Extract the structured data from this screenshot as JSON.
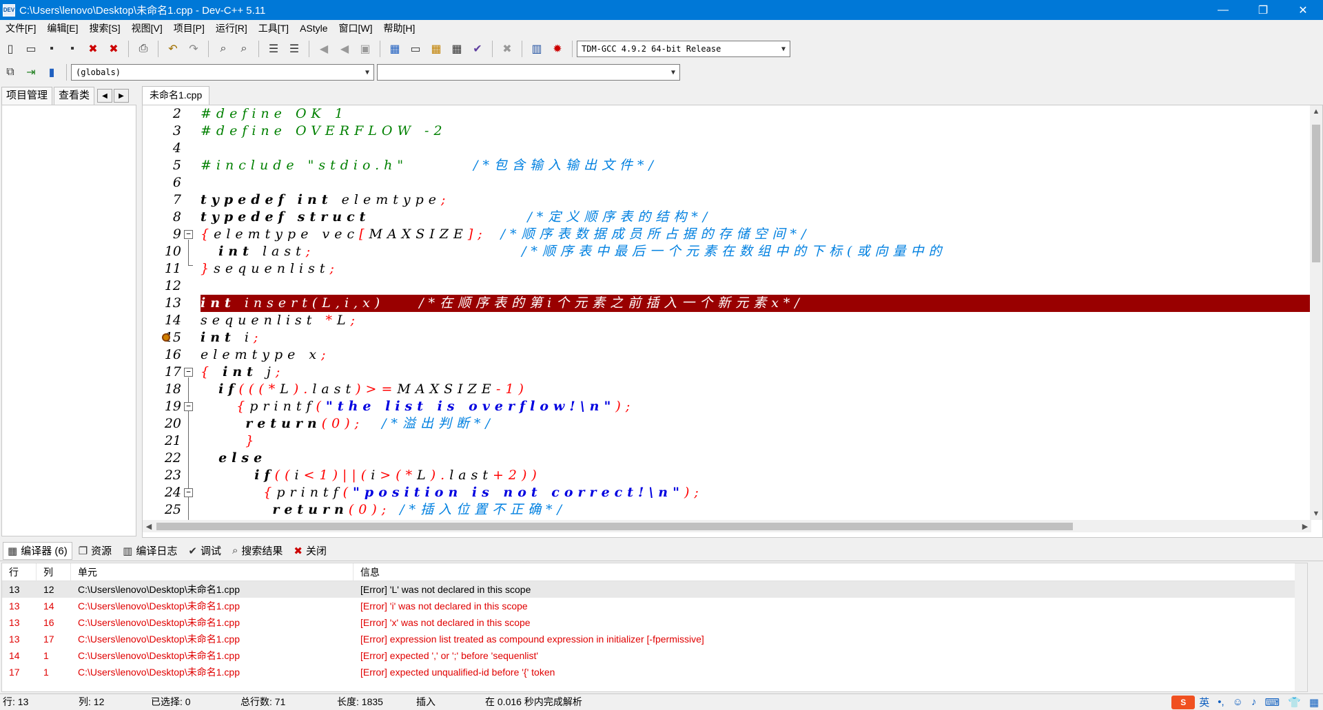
{
  "window": {
    "title": "C:\\Users\\lenovo\\Desktop\\未命名1.cpp - Dev-C++ 5.11",
    "app_icon_text": "DEV",
    "minimize": "—",
    "maximize": "❐",
    "close": "✕"
  },
  "menu": [
    "文件[F]",
    "编辑[E]",
    "搜索[S]",
    "视图[V]",
    "项目[P]",
    "运行[R]",
    "工具[T]",
    "AStyle",
    "窗口[W]",
    "帮助[H]"
  ],
  "toolbar": {
    "compiler_select": "TDM-GCC 4.9.2 64-bit Release",
    "scope_select": "(globals)",
    "member_select": ""
  },
  "left_panel": {
    "tabs": [
      "项目管理",
      "查看类"
    ],
    "nav_prev": "◀",
    "nav_next": "▶"
  },
  "editor": {
    "tab": "未命名1.cpp",
    "line_numbers": [
      "2",
      "3",
      "4",
      "5",
      "6",
      "7",
      "8",
      "9",
      "10",
      "11",
      "12",
      "13",
      "14",
      "15",
      "16",
      "17",
      "18",
      "19",
      "20",
      "21",
      "22",
      "23",
      "24",
      "25"
    ],
    "lines": {
      "l2a": "#define OK 1",
      "l3a": "#define OVERFLOW -2",
      "l5a": "#include \"stdio.h\"",
      "l5c": "/*包含输入输出文件*/",
      "l7k1": "typedef",
      "l7k2": "int",
      "l7t": "elemtype",
      "l7r": ";",
      "l8k1": "typedef",
      "l8k2": "struct",
      "l8c": "/*定义顺序表的结构*/",
      "l9r1": "{",
      "l9t": "elemtype vec",
      "l9r2": "[",
      "l9t2": "MAXSIZE",
      "l9r3": "];",
      "l9c": "/*顺序表数据成员所占据的存储空间*/",
      "l10k": "int",
      "l10t": "last",
      "l10r": ";",
      "l10c": "/*顺序表中最后一个元素在数组中的下标(或向量中的",
      "l11r1": "}",
      "l11t": "sequenlist",
      "l11r2": ";",
      "l13k": "int",
      "l13t": "insert",
      "l13b": "(L,i,x)",
      "l13c": "/*在顺序表的第i个元素之前插入一个新元素x*/",
      "l14t": "sequenlist",
      "l14r": "*",
      "l14t2": "L",
      "l14r2": ";",
      "l15k": "int",
      "l15t": "i",
      "l15r": ";",
      "l16t": "elemtype",
      "l16t2": "x",
      "l16r": ";",
      "l17r": "{",
      "l17k": "int",
      "l17t": "j",
      "l17r2": ";",
      "l18k": "if",
      "l18r": "(((*",
      "l18t": "L",
      "l18r2": ").",
      "l18t2": "last",
      "l18r3": ")>=",
      "l18t3": "MAXSIZE",
      "l18r4": "-1)",
      "l19r": "{",
      "l19t": "printf",
      "l19r2": "(",
      "l19s": "\"the list is overflow!\\n\"",
      "l19r3": ");",
      "l20k": "return",
      "l20r": "(0);",
      "l20c": "/*溢出判断*/",
      "l21r": "}",
      "l22k": "else",
      "l23k": "if",
      "l23r": "((",
      "l23t": "i",
      "l23r2": "<1)||(",
      "l23t2": "i",
      "l23r3": ">(*",
      "l23t3": "L",
      "l23r4": ").",
      "l23t4": "last",
      "l23r5": "+2))",
      "l24r": "{",
      "l24t": "printf",
      "l24r2": "(",
      "l24s": "\"position is not correct!\\n\"",
      "l24r3": ");",
      "l25k": "return",
      "l25r": "(0);",
      "l25c": "/*插入位置不正确*/"
    }
  },
  "bottom_panel": {
    "tabs": [
      {
        "icon": "▦",
        "label": "编译器 (6)"
      },
      {
        "icon": "❐",
        "label": "资源"
      },
      {
        "icon": "▥",
        "label": "编译日志"
      },
      {
        "icon": "✔",
        "label": "调试"
      },
      {
        "icon": "⌕",
        "label": "搜索结果"
      },
      {
        "icon": "✖",
        "label": "关闭"
      }
    ],
    "columns": [
      "行",
      "列",
      "单元",
      "信息"
    ],
    "rows": [
      {
        "line": "13",
        "col": "12",
        "unit": "C:\\Users\\lenovo\\Desktop\\未命名1.cpp",
        "msg": "[Error] 'L' was not declared in this scope"
      },
      {
        "line": "13",
        "col": "14",
        "unit": "C:\\Users\\lenovo\\Desktop\\未命名1.cpp",
        "msg": "[Error] 'i' was not declared in this scope"
      },
      {
        "line": "13",
        "col": "16",
        "unit": "C:\\Users\\lenovo\\Desktop\\未命名1.cpp",
        "msg": "[Error] 'x' was not declared in this scope"
      },
      {
        "line": "13",
        "col": "17",
        "unit": "C:\\Users\\lenovo\\Desktop\\未命名1.cpp",
        "msg": "[Error] expression list treated as compound expression in initializer [-fpermissive]"
      },
      {
        "line": "14",
        "col": "1",
        "unit": "C:\\Users\\lenovo\\Desktop\\未命名1.cpp",
        "msg": "[Error] expected ',' or ';' before 'sequenlist'"
      },
      {
        "line": "17",
        "col": "1",
        "unit": "C:\\Users\\lenovo\\Desktop\\未命名1.cpp",
        "msg": "[Error] expected unqualified-id before '{' token"
      }
    ]
  },
  "status": {
    "row_label": "行:",
    "row": "13",
    "col_label": "列:",
    "col": "12",
    "sel_label": "已选择:",
    "sel": "0",
    "total_label": "总行数:",
    "total": "71",
    "len_label": "长度:",
    "len": "1835",
    "mode": "插入",
    "parse": "在 0.016 秒内完成解析"
  },
  "tray": {
    "ime_logo": "S",
    "lang": "英",
    "items": [
      "•,",
      "☺",
      "♪",
      "⌨",
      "👕",
      "▦"
    ]
  }
}
